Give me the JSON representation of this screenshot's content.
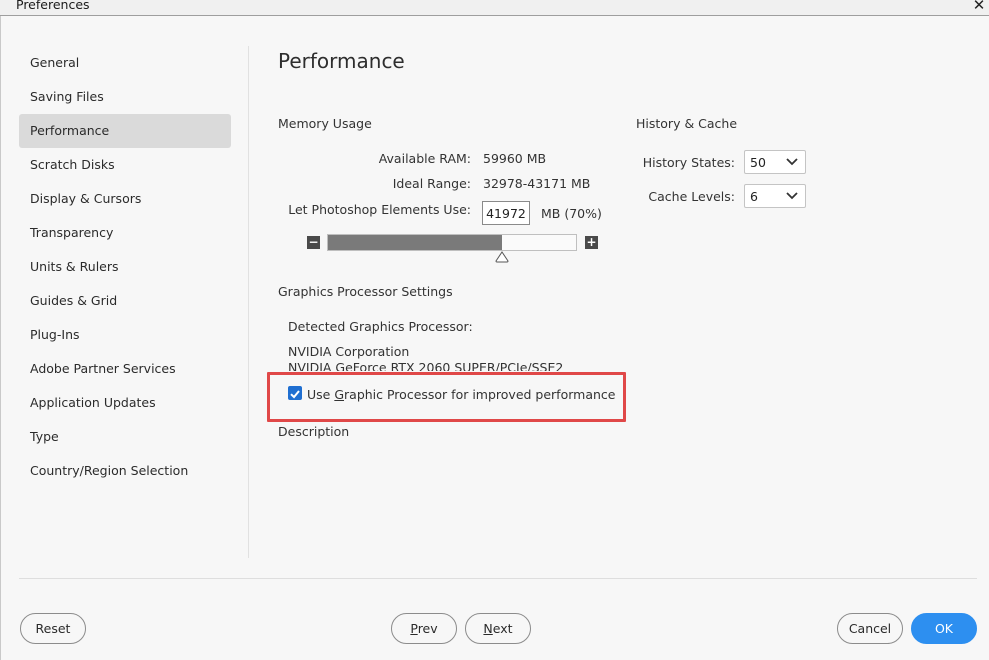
{
  "window": {
    "title": "Preferences"
  },
  "sidebar": {
    "items": [
      {
        "label": "General",
        "active": false
      },
      {
        "label": "Saving Files",
        "active": false
      },
      {
        "label": "Performance",
        "active": true
      },
      {
        "label": "Scratch Disks",
        "active": false
      },
      {
        "label": "Display & Cursors",
        "active": false
      },
      {
        "label": "Transparency",
        "active": false
      },
      {
        "label": "Units & Rulers",
        "active": false
      },
      {
        "label": "Guides & Grid",
        "active": false
      },
      {
        "label": "Plug-Ins",
        "active": false
      },
      {
        "label": "Adobe Partner Services",
        "active": false
      },
      {
        "label": "Application Updates",
        "active": false
      },
      {
        "label": "Type",
        "active": false
      },
      {
        "label": "Country/Region Selection",
        "active": false
      }
    ]
  },
  "main": {
    "title": "Performance",
    "memory": {
      "section_title": "Memory Usage",
      "available_ram_label": "Available RAM:",
      "available_ram_value": "59960 MB",
      "ideal_range_label": "Ideal Range:",
      "ideal_range_value": "32978-43171 MB",
      "let_use_label": "Let Photoshop Elements Use:",
      "let_use_value": "41972",
      "let_use_unit": "MB (70%)",
      "slider_fraction": 0.7,
      "minus_label": "−",
      "plus_label": "+"
    },
    "history": {
      "section_title": "History & Cache",
      "history_states_label": "History States:",
      "history_states_value": "50",
      "cache_levels_label": "Cache Levels:",
      "cache_levels_value": "6"
    },
    "gpu": {
      "section_title": "Graphics Processor Settings",
      "detected_label": "Detected Graphics Processor:",
      "vendor": "NVIDIA Corporation",
      "model": "NVIDIA GeForce RTX 2060 SUPER/PCIe/SSE2",
      "use_gpu_prefix": "Use ",
      "use_gpu_mnemonic": "G",
      "use_gpu_rest": "raphic Processor for improved performance",
      "use_gpu_checked": true,
      "description_label": "Description"
    }
  },
  "footer": {
    "reset_label": "Reset",
    "prev_mnemonic": "P",
    "prev_rest": "rev",
    "next_mnemonic": "N",
    "next_rest": "ext",
    "cancel_label": "Cancel",
    "ok_label": "OK"
  },
  "colors": {
    "accent": "#2d8ff0",
    "checkbox": "#1f6fd1",
    "highlight": "#e04848"
  }
}
